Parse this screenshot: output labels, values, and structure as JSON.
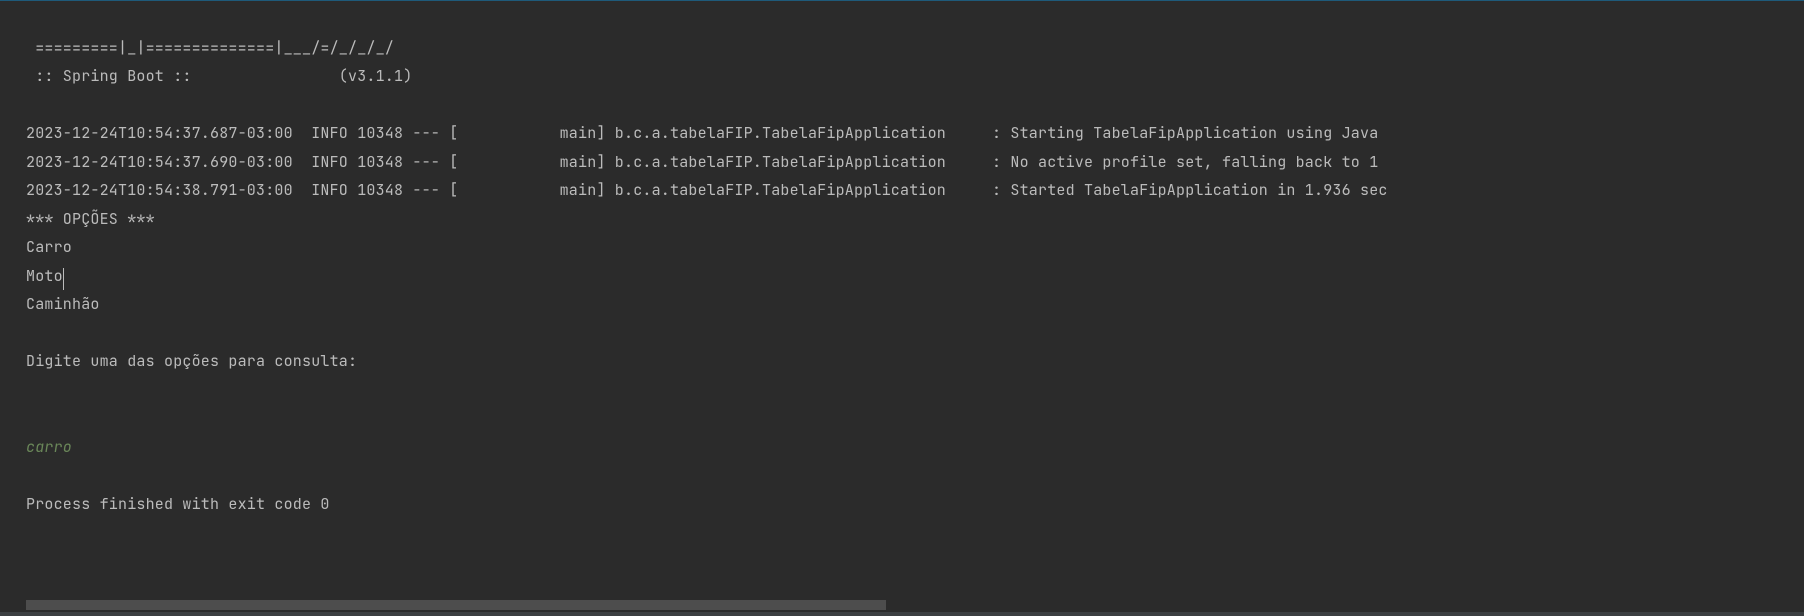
{
  "console": {
    "banner_line1": " =========|_|==============|___/=/_/_/_/",
    "banner_line2": " :: Spring Boot ::                (v3.1.1)",
    "log_lines": [
      "2023-12-24T10:54:37.687-03:00  INFO 10348 --- [           main] b.c.a.tabelaFIP.TabelaFipApplication     : Starting TabelaFipApplication using Java ",
      "2023-12-24T10:54:37.690-03:00  INFO 10348 --- [           main] b.c.a.tabelaFIP.TabelaFipApplication     : No active profile set, falling back to 1 ",
      "2023-12-24T10:54:38.791-03:00  INFO 10348 --- [           main] b.c.a.tabelaFIP.TabelaFipApplication     : Started TabelaFipApplication in 1.936 sec"
    ],
    "options_header": "*** OPÇÕES ***",
    "option1": "Carro",
    "option2": "Moto",
    "option3": "Caminhão",
    "prompt": "Digite uma das opções para consulta:",
    "user_input": "carro",
    "exit_message": "Process finished with exit code 0"
  }
}
